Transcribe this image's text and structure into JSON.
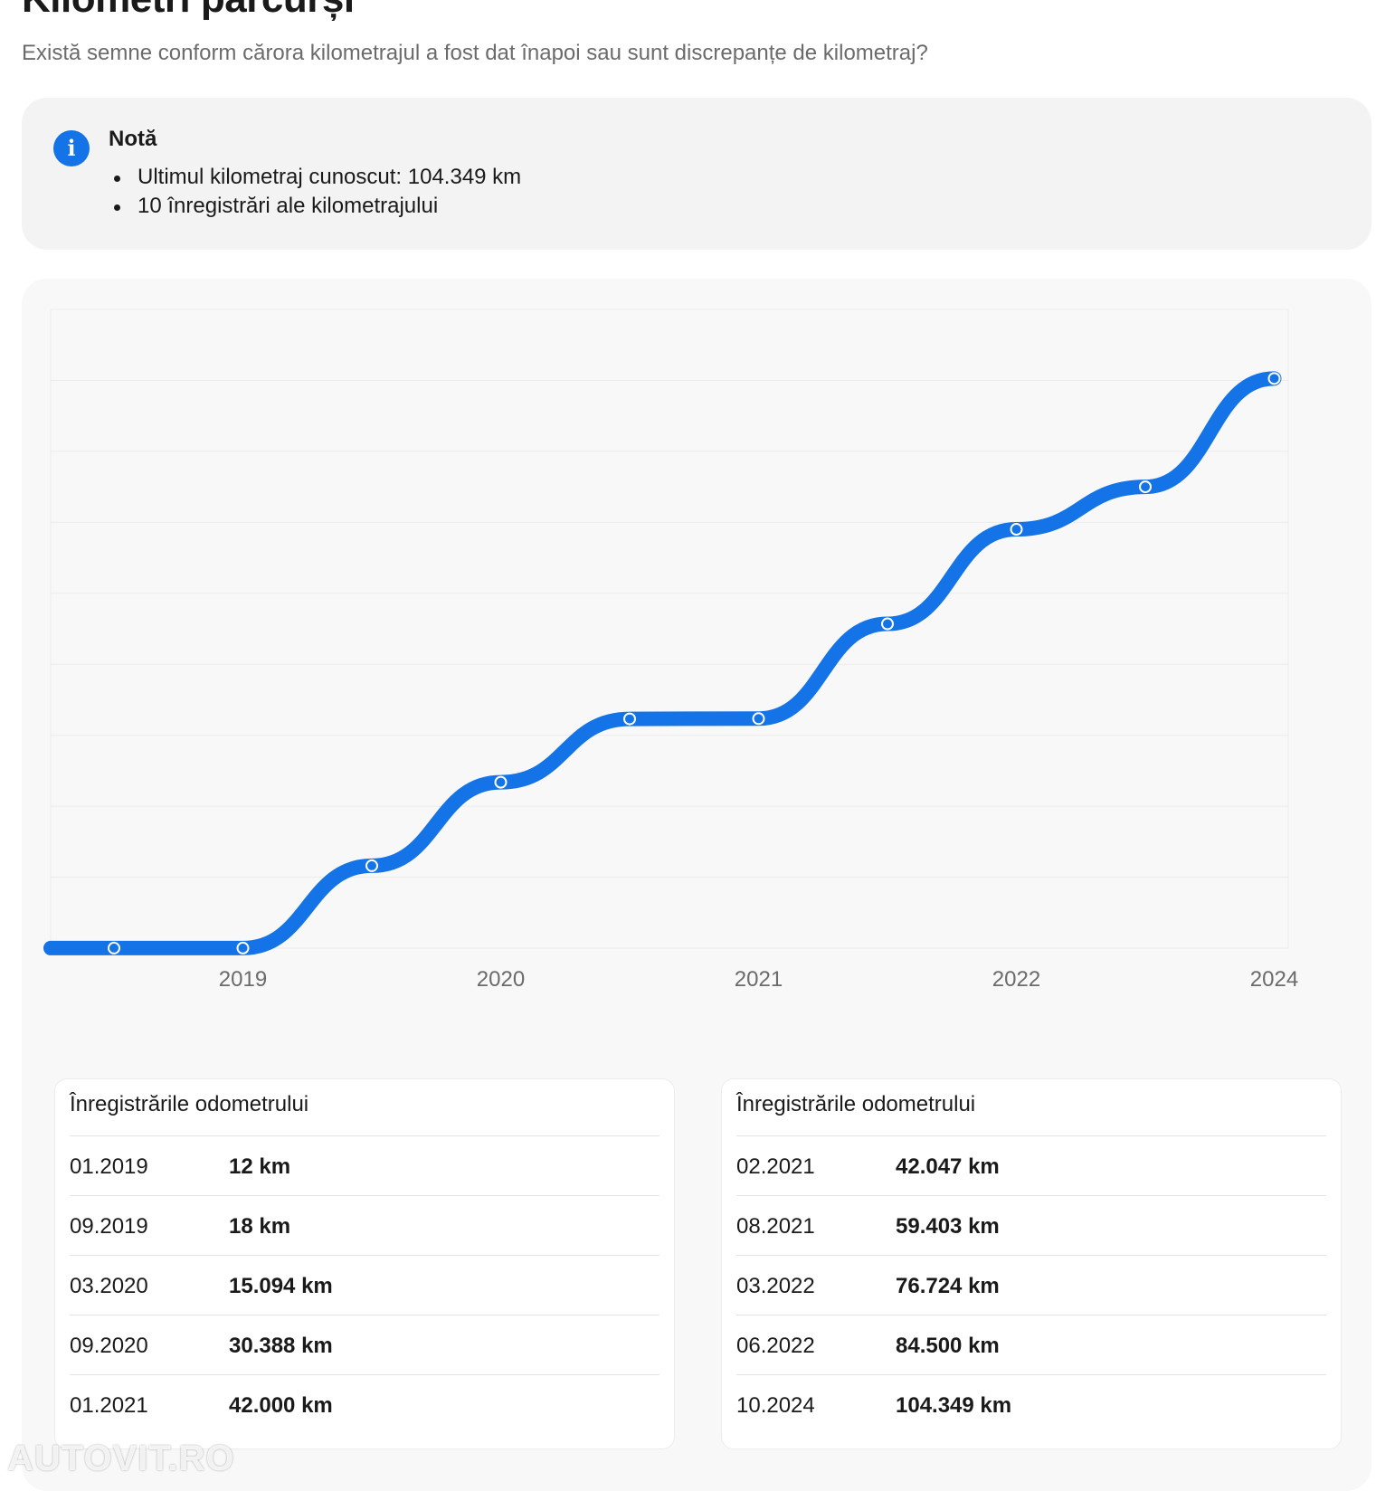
{
  "page": {
    "title": "Kilometri parcurși",
    "subtitle": "Există semne conform cărora kilometrajul a fost dat înapoi sau sunt discrepanțe de kilometraj?"
  },
  "note": {
    "icon": "info-icon",
    "title": "Notă",
    "items": [
      "Ultimul kilometraj cunoscut: 104.349 km",
      "10 înregistrări ale kilometrajului"
    ]
  },
  "colors": {
    "accent": "#1473e6",
    "card_bg": "#f3f3f3"
  },
  "chart_data": {
    "type": "line",
    "x": [
      "01.2019",
      "09.2019",
      "03.2020",
      "09.2020",
      "01.2021",
      "02.2021",
      "08.2021",
      "03.2022",
      "06.2022",
      "10.2024"
    ],
    "values": [
      12,
      18,
      15094,
      30388,
      42000,
      42047,
      59403,
      76724,
      84500,
      104349
    ],
    "xticks": [
      "2019",
      "2020",
      "2021",
      "2022",
      "2024"
    ],
    "grid": true,
    "smooth": true
  },
  "tables": [
    {
      "title": "Înregistrările odometrului",
      "rows": [
        {
          "date": "01.2019",
          "km": "12 km"
        },
        {
          "date": "09.2019",
          "km": "18 km"
        },
        {
          "date": "03.2020",
          "km": "15.094 km"
        },
        {
          "date": "09.2020",
          "km": "30.388 km"
        },
        {
          "date": "01.2021",
          "km": "42.000 km"
        }
      ]
    },
    {
      "title": "Înregistrările odometrului",
      "rows": [
        {
          "date": "02.2021",
          "km": "42.047 km"
        },
        {
          "date": "08.2021",
          "km": "59.403 km"
        },
        {
          "date": "03.2022",
          "km": "76.724 km"
        },
        {
          "date": "06.2022",
          "km": "84.500 km"
        },
        {
          "date": "10.2024",
          "km": "104.349 km"
        }
      ]
    }
  ],
  "watermark": "AUTOVIT.RO"
}
